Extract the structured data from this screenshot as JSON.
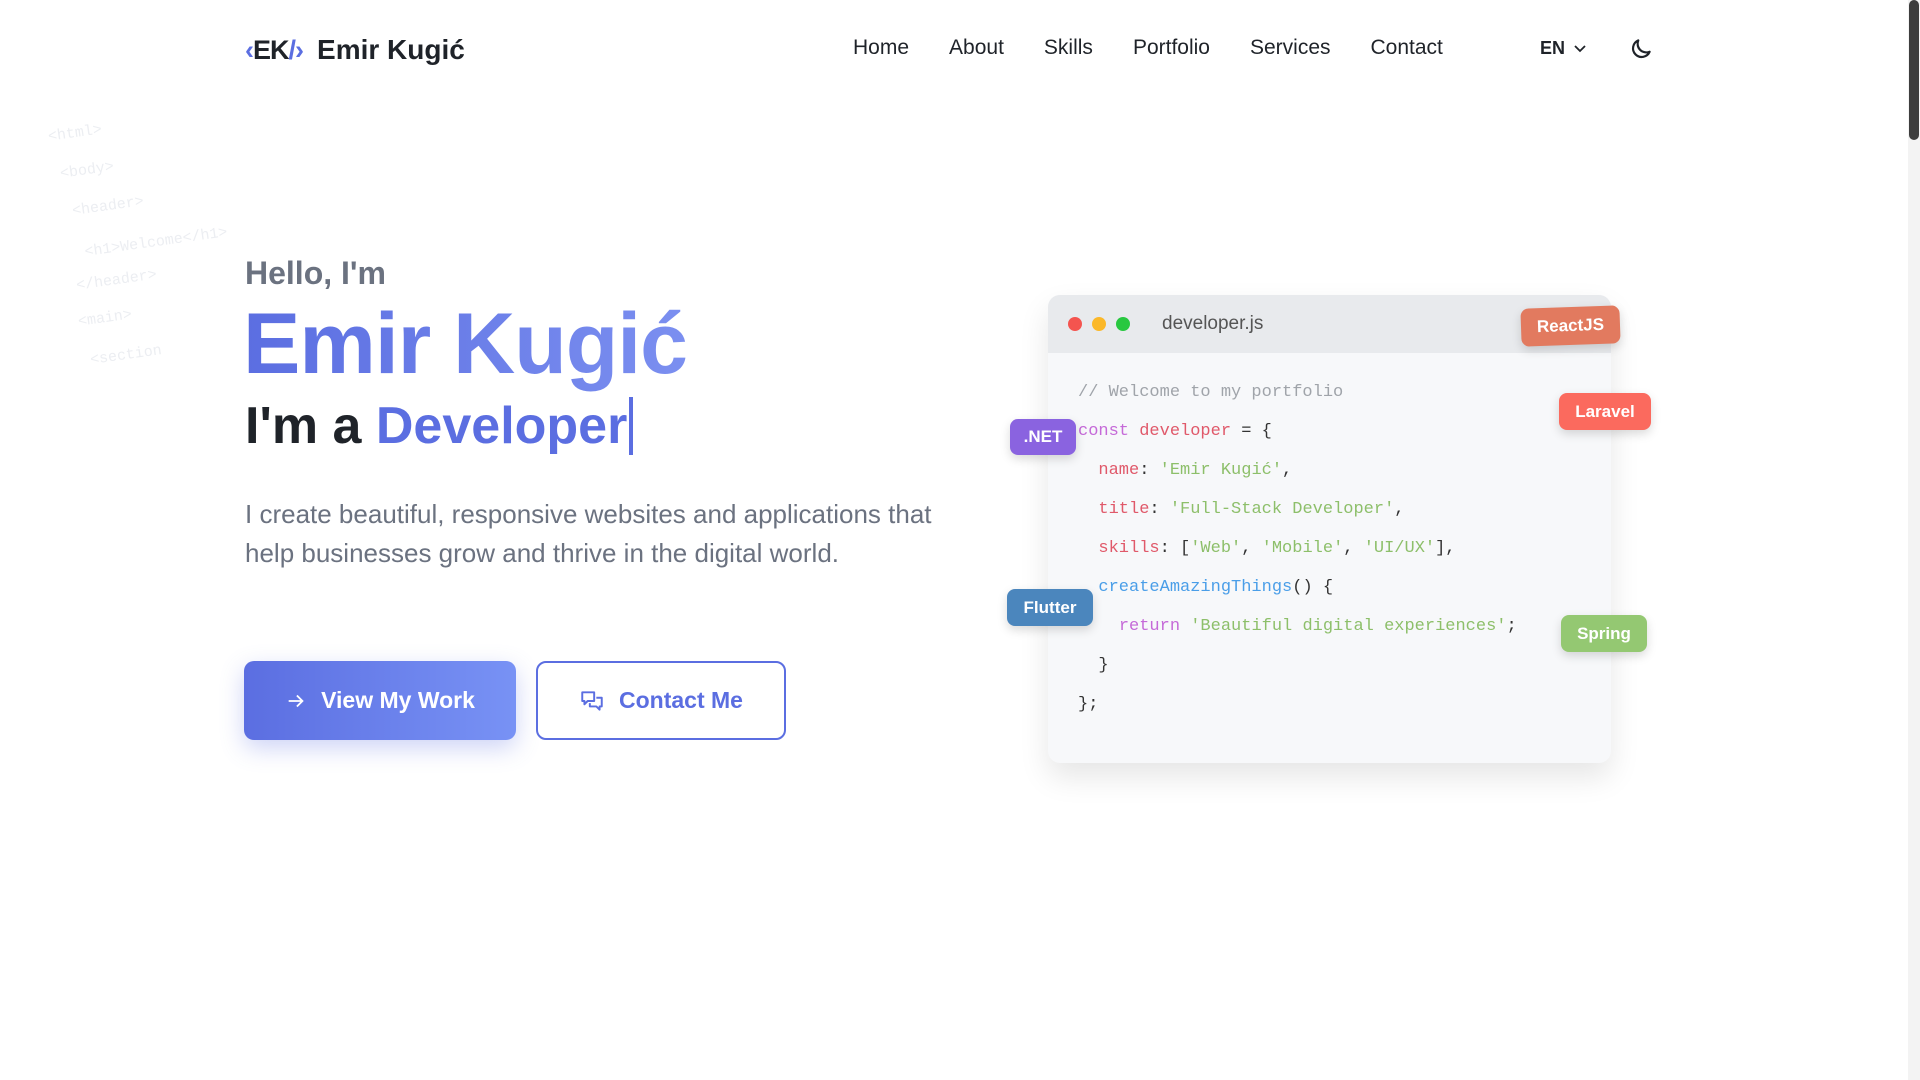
{
  "header": {
    "logo_left": "‹",
    "logo_letters": "EK",
    "logo_slash": "/",
    "logo_right": "›",
    "brand_name": "Emir Kugić",
    "nav": [
      "Home",
      "About",
      "Skills",
      "Portfolio",
      "Services",
      "Contact"
    ],
    "language": "EN"
  },
  "background_code": [
    "<html>",
    "<body>",
    "<header>",
    "<h1>Welcome</h1>",
    "</header>",
    "<main>",
    "<section"
  ],
  "hero": {
    "greeting": "Hello, I'm",
    "name": "Emir Kugić",
    "role_prefix": "I'm a",
    "role_typed": "Developer",
    "description": "I create beautiful, responsive websites and applications that help businesses grow and thrive in the digital world.",
    "primary_button": "View My Work",
    "secondary_button": "Contact Me"
  },
  "code_window": {
    "filename": "developer.js",
    "lines": [
      [
        [
          "// Welcome to my portfolio",
          "comment"
        ]
      ],
      [
        [
          "const",
          "kw"
        ],
        [
          " ",
          "p"
        ],
        [
          "developer",
          "var"
        ],
        [
          " = {",
          "p"
        ]
      ],
      [
        [
          "  ",
          "p"
        ],
        [
          "name",
          "var"
        ],
        [
          ": ",
          "p"
        ],
        [
          "'Emir Kugić'",
          "str"
        ],
        [
          ",",
          "p"
        ]
      ],
      [
        [
          "  ",
          "p"
        ],
        [
          "title",
          "var"
        ],
        [
          ": ",
          "p"
        ],
        [
          "'Full-Stack Developer'",
          "str"
        ],
        [
          ",",
          "p"
        ]
      ],
      [
        [
          "  ",
          "p"
        ],
        [
          "skills",
          "var"
        ],
        [
          ": [",
          "p"
        ],
        [
          "'Web'",
          "str"
        ],
        [
          ", ",
          "p"
        ],
        [
          "'Mobile'",
          "str"
        ],
        [
          ", ",
          "p"
        ],
        [
          "'UI/UX'",
          "str"
        ],
        [
          "],",
          "p"
        ]
      ],
      [
        [
          "  ",
          "p"
        ],
        [
          "createAmazingThings",
          "fn"
        ],
        [
          "() {",
          "p"
        ]
      ],
      [
        [
          "    ",
          "p"
        ],
        [
          "return",
          "kw"
        ],
        [
          " ",
          "p"
        ],
        [
          "'Beautiful digital experiences'",
          "str"
        ],
        [
          ";",
          "p"
        ]
      ],
      [
        [
          "  }",
          "p"
        ]
      ],
      [
        [
          "};",
          "p"
        ]
      ]
    ]
  },
  "badges": [
    {
      "label": "ReactJS",
      "color": "#e27a5f"
    },
    {
      "label": "Laravel",
      "color": "#fb6a5e"
    },
    {
      "label": ".NET",
      "color": "#8a63e0"
    },
    {
      "label": "Flutter",
      "color": "#4b86bd"
    },
    {
      "label": "Spring",
      "color": "#94c872"
    }
  ],
  "colors": {
    "accent": "#5b6ee1",
    "comment": "#a0a4aa",
    "kw": "#c56ad8",
    "var": "#e0596a",
    "str": "#8dbf6a",
    "fn": "#4a9ee8",
    "p": "#333333"
  }
}
